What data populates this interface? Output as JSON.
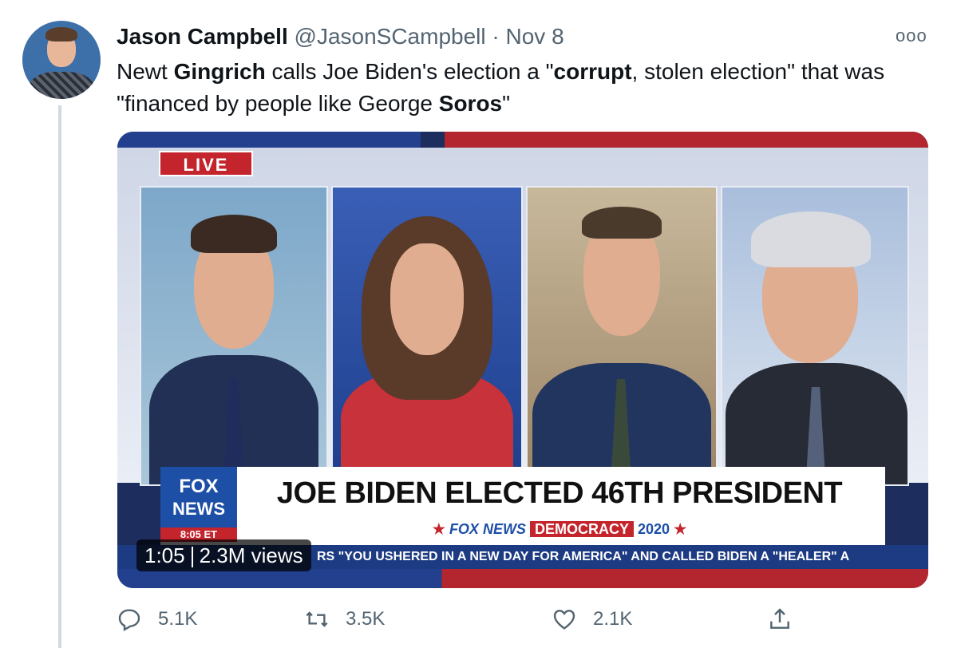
{
  "tweet": {
    "author_name": "Jason Campbell",
    "handle": "@JasonSCampbell",
    "separator": "·",
    "date": "Nov 8",
    "text_parts": [
      {
        "text": "Newt ",
        "bold": false
      },
      {
        "text": "Gingrich",
        "bold": true
      },
      {
        "text": " calls Joe Biden's election a \"",
        "bold": false
      },
      {
        "text": "corrupt",
        "bold": true
      },
      {
        "text": ", stolen election\" that was \"financed by people like George ",
        "bold": false
      },
      {
        "text": "Soros",
        "bold": true
      },
      {
        "text": "\"",
        "bold": false
      }
    ]
  },
  "video": {
    "live_label": "LIVE",
    "logo_fox": "FOX",
    "logo_news": "NEWS",
    "logo_time": "8:05 ET",
    "headline": "JOE BIDEN ELECTED 46TH PRESIDENT",
    "brand_star": "★",
    "brand_name": "FOX NEWS",
    "brand_democracy": "DEMOCRACY",
    "brand_year": "2020",
    "ticker": "RS \"YOU USHERED IN A NEW DAY FOR AMERICA\" AND CALLED BIDEN A \"HEALER\" A",
    "duration": "1:05",
    "views": "2.3M views"
  },
  "actions": {
    "reply_count": "5.1K",
    "retweet_count": "3.5K",
    "like_count": "2.1K"
  },
  "icons": {
    "more": "more-icon",
    "reply": "reply-icon",
    "retweet": "retweet-icon",
    "like": "like-icon",
    "share": "share-icon"
  }
}
